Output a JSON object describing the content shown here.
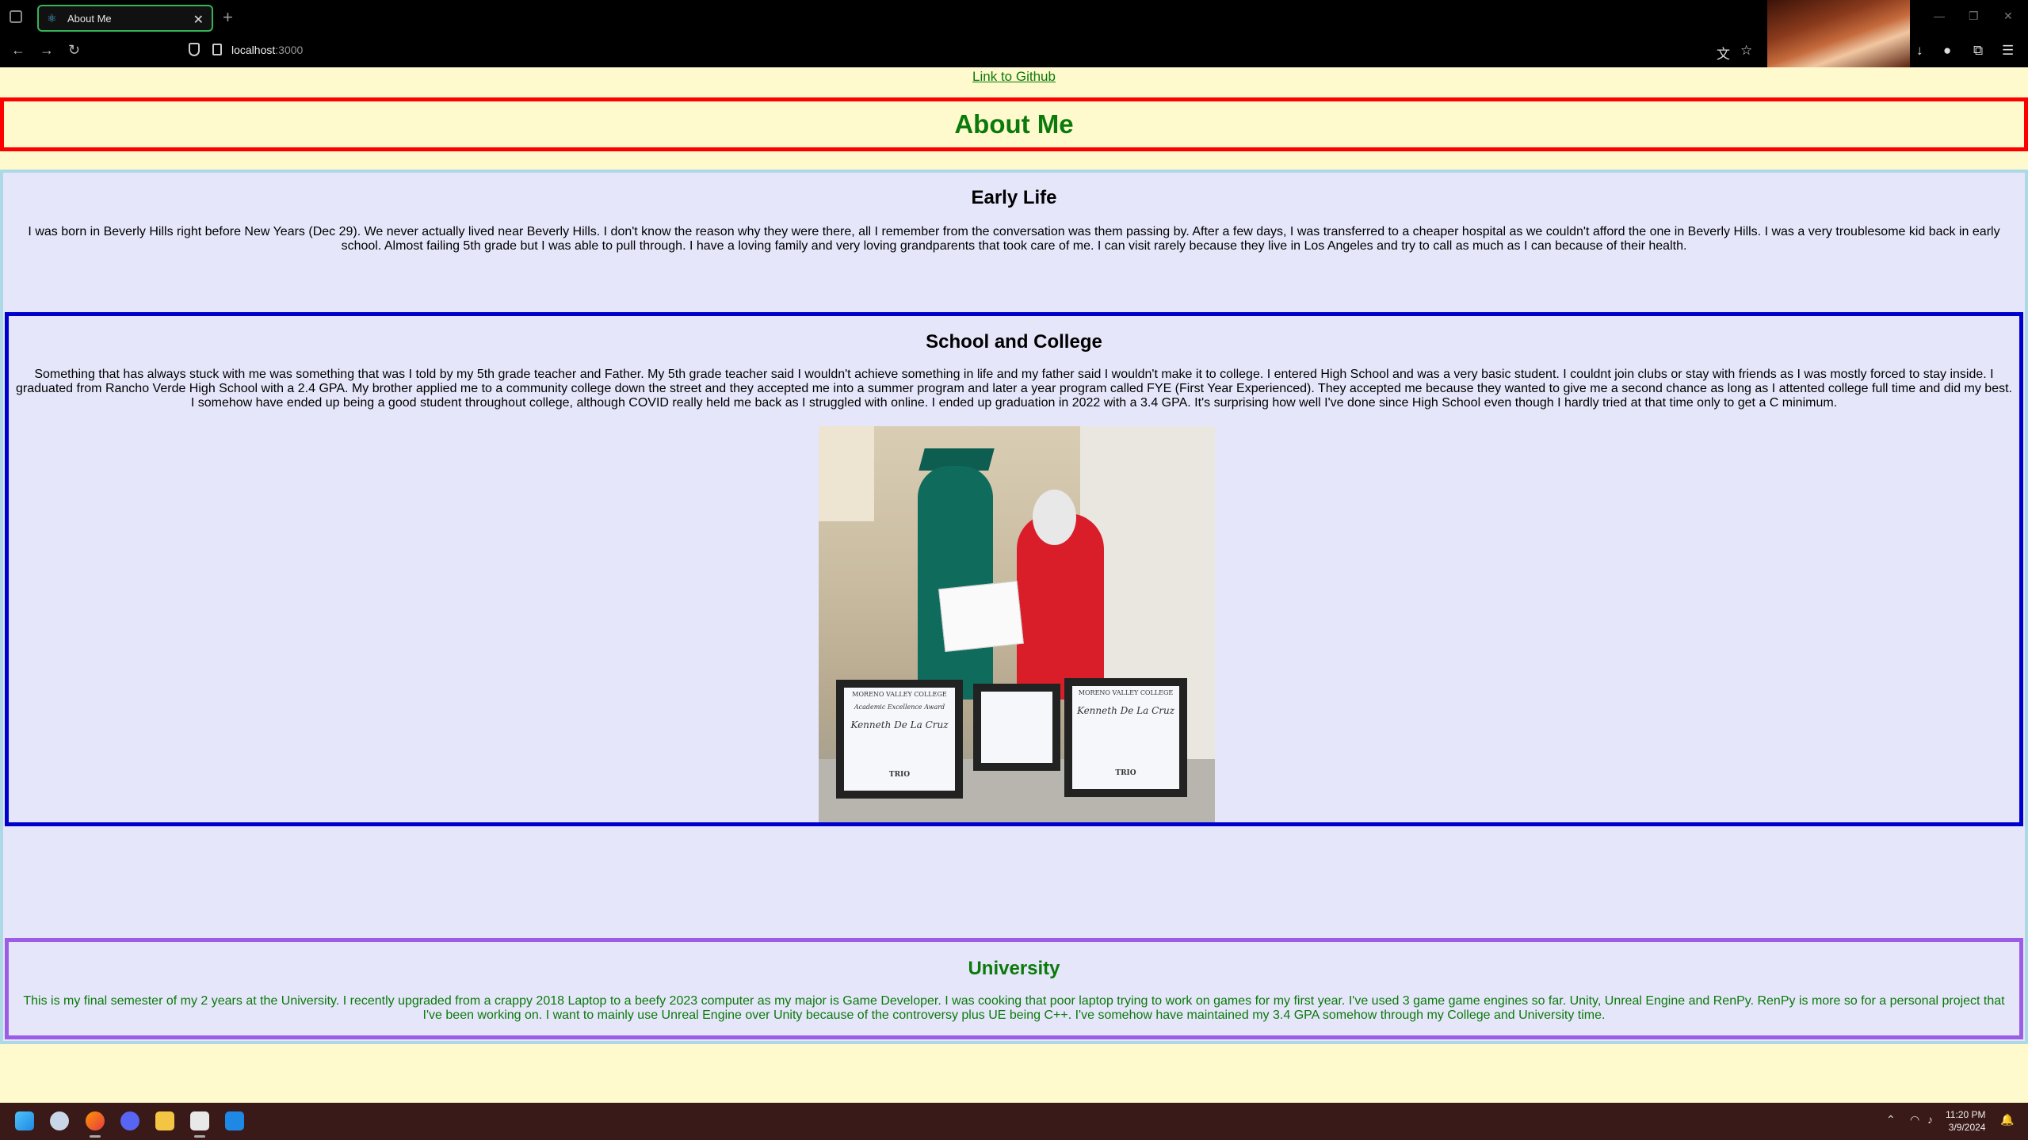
{
  "browser": {
    "tab_title": "About Me",
    "tab_close": "✕",
    "new_tab": "+",
    "url_host": "localhost",
    "url_port": ":3000"
  },
  "page": {
    "github_link": "Link to Github",
    "title": "About Me",
    "early_life": {
      "heading": "Early Life",
      "text": "I was born in Beverly Hills right before New Years (Dec 29). We never actually lived near Beverly Hills. I don't know the reason why they were there, all I remember from the conversation was them passing by. After a few days, I was transferred to a cheaper hospital as we couldn't afford the one in Beverly Hills. I was a very troublesome kid back in early school. Almost failing 5th grade but I was able to pull through. I have a loving family and very loving grandparents that took care of me. I can visit rarely because they live in Los Angeles and try to call as much as I can because of their health."
    },
    "school": {
      "heading": "School and College",
      "text": "Something that has always stuck with me was something that was I told by my 5th grade teacher and Father. My 5th grade teacher said I wouldn't achieve something in life and my father said I wouldn't make it to college. I entered High School and was a very basic student. I couldnt join clubs or stay with friends as I was mostly forced to stay inside. I graduated from Rancho Verde High School with a 2.4 GPA. My brother applied me to a community college down the street and they accepted me into a summer program and later a year program called FYE (First Year Experienced). They accepted me because they wanted to give me a second chance as long as I attented college full time and did my best. I somehow have ended up being a good student throughout college, although COVID really held me back as I struggled with online. I ended up graduation in 2022 with a 3.4 GPA. It's surprising how well I've done since High School even though I hardly tried at that time only to get a C minimum.",
      "photo": {
        "cert_left_college": "MORENO VALLEY COLLEGE",
        "cert_left_award": "Academic Excellence Award",
        "cert_left_name": "Kenneth De La Cruz",
        "cert_left_trio": "TRIO",
        "cert_right_college": "MORENO VALLEY COLLEGE",
        "cert_right_name": "Kenneth De La Cruz",
        "cert_right_trio": "TRIO"
      }
    },
    "university": {
      "heading": "University",
      "text": "This is my final semester of my 2 years at the University. I recently upgraded from a crappy 2018 Laptop to a beefy 2023 computer as my major is Game Developer. I was cooking that poor laptop trying to work on games for my first year. I've used 3 game game engines so far. Unity, Unreal Engine and RenPy. RenPy is more so for a personal project that I've been working on. I want to mainly use Unreal Engine over Unity because of the controversy plus UE being C++. I've somehow have maintained my 3.4 GPA somehow through my College and University time."
    }
  },
  "taskbar": {
    "time": "11:20 PM",
    "date": "3/9/2024"
  },
  "colors": {
    "page_bg": "#fffacd",
    "content_bg": "#e6e6fa",
    "title_green": "#0a7a0a",
    "header_border": "#ff0000",
    "school_border": "#0000cd",
    "university_border": "#9b5de5",
    "content_border": "#add8e6"
  }
}
